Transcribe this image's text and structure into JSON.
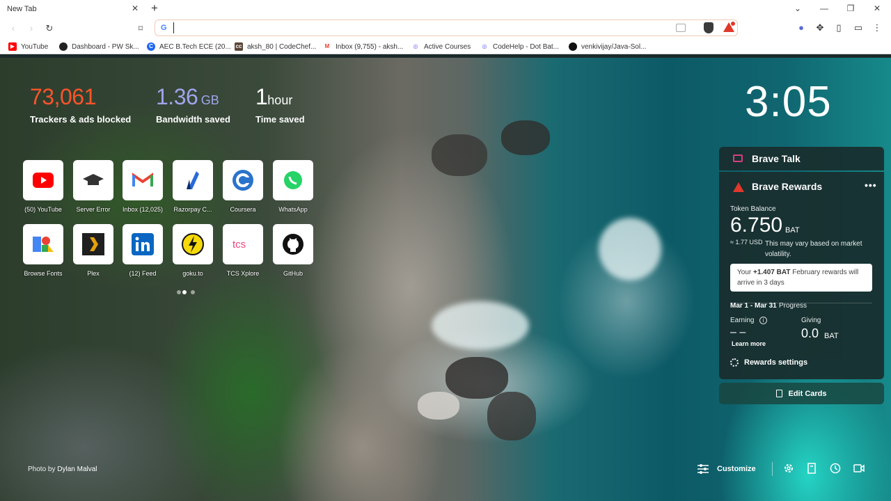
{
  "tabs": [
    {
      "title": "New Tab"
    }
  ],
  "omnibox": {
    "value": "",
    "engine_icon": "G"
  },
  "bookmarks": [
    {
      "label": "YouTube",
      "icon": "youtube-icon",
      "color": "#ff0000"
    },
    {
      "label": "Dashboard - PW Sk...",
      "icon": "pw-icon",
      "color": "#222222"
    },
    {
      "label": "AEC B.Tech ECE (20...",
      "icon": "classroom-icon",
      "color": "#1e66f5"
    },
    {
      "label": "aksh_80 | CodeChef...",
      "icon": "codechef-icon",
      "color": "#5b4638"
    },
    {
      "label": "Inbox (9,755) - aksh...",
      "icon": "gmail-icon",
      "color": "#ea4335"
    },
    {
      "label": "Active Courses",
      "icon": "codehelp-icon",
      "color": "#6b63ff"
    },
    {
      "label": "CodeHelp - Dot Bat...",
      "icon": "codehelp-icon",
      "color": "#6b63ff"
    },
    {
      "label": "venkivijay/Java-Sol...",
      "icon": "github-icon",
      "color": "#111111"
    }
  ],
  "stats": {
    "trackers": {
      "value": "73,061",
      "label": "Trackers & ads blocked",
      "color": "#fb542b"
    },
    "bandwidth": {
      "value": "1.36",
      "unit": "GB",
      "label": "Bandwidth saved",
      "color": "#a0a5eb"
    },
    "time": {
      "value": "1",
      "unit": "hour",
      "label": "Time saved"
    }
  },
  "clock": "3:05",
  "top_sites": [
    {
      "label": "(50) YouTube",
      "icon": "youtube-icon"
    },
    {
      "label": "Server Error",
      "icon": "graduation-cap-icon"
    },
    {
      "label": "Inbox (12,025)",
      "icon": "gmail-icon"
    },
    {
      "label": "Razorpay C...",
      "icon": "razorpay-icon"
    },
    {
      "label": "Coursera",
      "icon": "coursera-icon"
    },
    {
      "label": "WhatsApp",
      "icon": "whatsapp-icon"
    },
    {
      "label": "Browse Fonts",
      "icon": "google-fonts-icon"
    },
    {
      "label": "Plex",
      "icon": "plex-icon"
    },
    {
      "label": "(12) Feed",
      "icon": "linkedin-icon"
    },
    {
      "label": "goku.to",
      "icon": "goku-icon"
    },
    {
      "label": "TCS Xplore",
      "icon": "tcs-icon"
    },
    {
      "label": "GitHub",
      "icon": "github-icon"
    }
  ],
  "talk": {
    "title": "Brave Talk"
  },
  "rewards": {
    "title": "Brave Rewards",
    "menu": "•••",
    "token_label": "Token Balance",
    "balance": "6.750",
    "balance_unit": "BAT",
    "usd": "≈ 1.77 USD",
    "volatility": "This may vary based on market volatility.",
    "notice_prefix": "Your",
    "notice_amount": "+1.407 BAT",
    "notice_suffix": "February rewards will arrive in 3 days",
    "progress_range": "Mar 1 - Mar 31",
    "progress_label": "Progress",
    "earning_label": "Earning",
    "earning_value": "– –",
    "learn_more": "Learn more",
    "giving_label": "Giving",
    "giving_value": "0.0",
    "giving_unit": "BAT",
    "settings_label": "Rewards settings"
  },
  "edit_cards": "Edit Cards",
  "photo_credit": {
    "prefix": "Photo by",
    "author": "Dylan Malval"
  },
  "bottom": {
    "customize": "Customize"
  }
}
